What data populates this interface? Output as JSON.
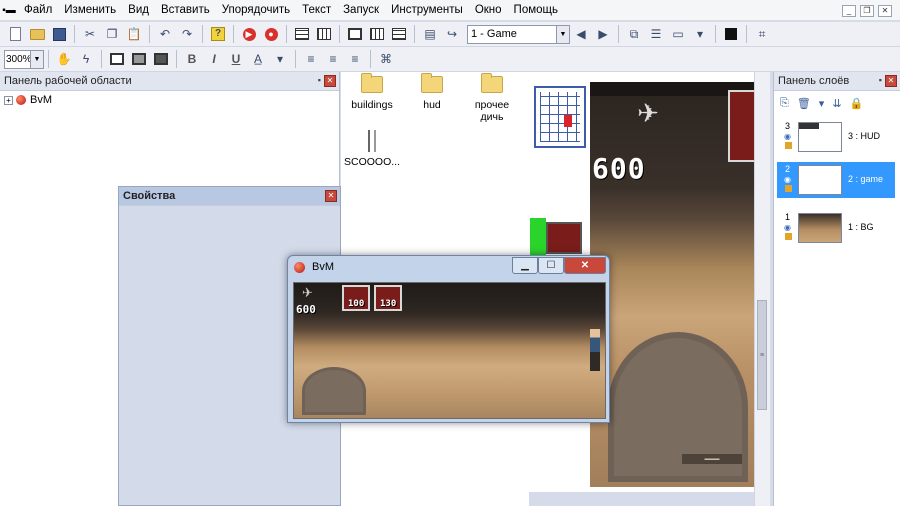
{
  "menu": [
    "Файл",
    "Изменить",
    "Вид",
    "Вставить",
    "Упорядочить",
    "Текст",
    "Запуск",
    "Инструменты",
    "Окно",
    "Помощь"
  ],
  "toolbar": {
    "zoom_value": "300%",
    "layout_select": "1 - Game",
    "bold": "B",
    "italic": "I",
    "underline": "U"
  },
  "workspace": {
    "title": "Панель рабочей области",
    "root_item": "BvM"
  },
  "properties": {
    "title": "Свойства"
  },
  "files": [
    {
      "name": "buildings",
      "type": "folder"
    },
    {
      "name": "hud",
      "type": "folder"
    },
    {
      "name": "прочее дичь",
      "type": "folder"
    },
    {
      "name": "SCOOOO...",
      "type": "sprite"
    }
  ],
  "layers_panel": {
    "title": "Панель слоёв",
    "layers": [
      {
        "index": "3",
        "name": "3 : HUD",
        "selected": false
      },
      {
        "index": "2",
        "name": "2 : game",
        "selected": true
      },
      {
        "index": "1",
        "name": "1 : BG",
        "selected": false
      }
    ]
  },
  "canvas": {
    "score": "600"
  },
  "game_window": {
    "title": "BvM",
    "score": "600",
    "cost1": "100",
    "cost2": "130"
  },
  "colors": {
    "selection": "#3399ff",
    "panel_bg": "#d3dbea"
  }
}
